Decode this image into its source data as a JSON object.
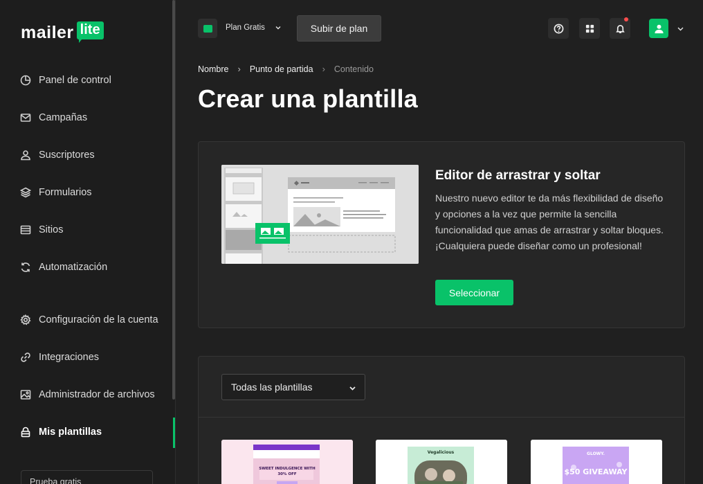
{
  "app": {
    "logo_word": "mailer",
    "logo_badge": "lite"
  },
  "sidebar": {
    "items": [
      {
        "label": "Panel de control",
        "icon": "clock-chart-icon"
      },
      {
        "label": "Campañas",
        "icon": "envelope-icon"
      },
      {
        "label": "Suscriptores",
        "icon": "user-icon"
      },
      {
        "label": "Formularios",
        "icon": "layers-icon"
      },
      {
        "label": "Sitios",
        "icon": "browser-icon"
      },
      {
        "label": "Automatización",
        "icon": "refresh-icon"
      },
      {
        "label": "Configuración de la cuenta",
        "icon": "gear-icon"
      },
      {
        "label": "Integraciones",
        "icon": "link-icon"
      },
      {
        "label": "Administrador de archivos",
        "icon": "image-icon"
      },
      {
        "label": "Mis plantillas",
        "icon": "lock-icon",
        "active": true
      }
    ],
    "trial_label": "Prueba gratis"
  },
  "topbar": {
    "plan_name": "Plan Gratis",
    "upgrade_label": "Subir de plan",
    "icons": [
      "help-icon",
      "apps-grid-icon",
      "bell-icon"
    ],
    "notification_dot_color": "#ff4d4d"
  },
  "breadcrumb": {
    "items": [
      "Nombre",
      "Punto de partida",
      "Contenido"
    ]
  },
  "page": {
    "title": "Crear una plantilla"
  },
  "editor_card": {
    "title": "Editor de arrastrar y soltar",
    "description": "Nuestro nuevo editor te da más flexibilidad de diseño y opciones a la vez que permite la sencilla funcionalidad que amas de arrastrar y soltar bloques. ¡Cualquiera puede diseñar como un profesional!",
    "button_label": "Seleccionar"
  },
  "templates": {
    "filter_value": "Todas las plantillas",
    "thumbnails": [
      {
        "headline": "SWEET INDULGENCE WITH 30% OFF"
      },
      {
        "headline": "Vegalicious"
      },
      {
        "headline": "GLOWY.",
        "sub": "$50 GIVEAWAY"
      }
    ]
  },
  "colors": {
    "accent": "#09c269",
    "background": "#202020",
    "sidebar": "#1d1d1d",
    "card": "#262626"
  }
}
